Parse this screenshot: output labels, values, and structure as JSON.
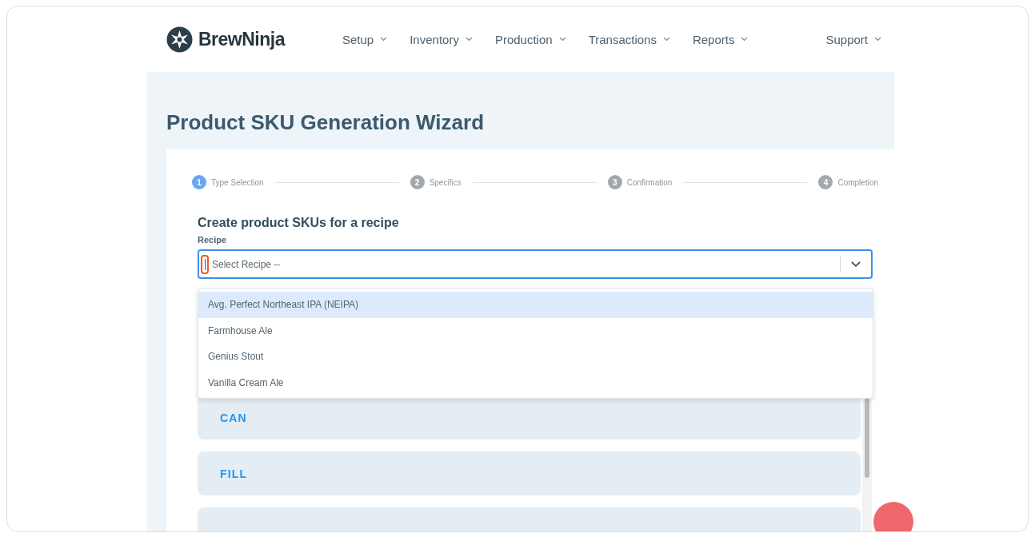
{
  "brand": {
    "name": "BrewNinja"
  },
  "nav": [
    {
      "label": "Setup"
    },
    {
      "label": "Inventory"
    },
    {
      "label": "Production"
    },
    {
      "label": "Transactions"
    },
    {
      "label": "Reports"
    },
    {
      "label": "Support"
    }
  ],
  "page": {
    "title": "Product SKU Generation Wizard"
  },
  "steps": [
    {
      "number": "1",
      "label": "Type Selection",
      "selected": true
    },
    {
      "number": "2",
      "label": "Specifics",
      "selected": false
    },
    {
      "number": "3",
      "label": "Confirmation",
      "selected": false
    },
    {
      "number": "4",
      "label": "Completion",
      "selected": false
    }
  ],
  "form": {
    "heading": "Create product SKUs for a recipe",
    "label": "Recipe",
    "placeholder": "Select Recipe --",
    "expanded": true
  },
  "options": [
    {
      "label": "Avg. Perfect Northeast IPA (NEIPA)",
      "selected": true
    },
    {
      "label": "Farmhouse Ale",
      "selected": false
    },
    {
      "label": "Genius Stout",
      "selected": false
    },
    {
      "label": "Vanilla Cream Ale",
      "selected": false
    }
  ],
  "panels": [
    {
      "label": "CAN"
    },
    {
      "label": "FILL"
    }
  ]
}
